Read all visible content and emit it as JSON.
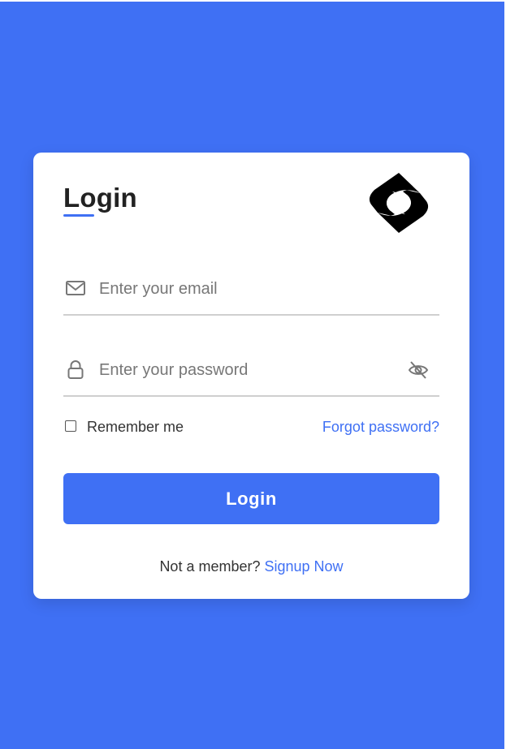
{
  "form": {
    "title": "Login",
    "email_placeholder": "Enter your email",
    "password_placeholder": "Enter your password",
    "remember_label": "Remember me",
    "forgot_label": "Forgot password?",
    "login_button_label": "Login",
    "signup_prompt": "Not a member?",
    "signup_link_label": "Signup Now"
  },
  "icons": {
    "email": "envelope-icon",
    "password": "lock-icon",
    "toggle_password": "eye-slash-icon",
    "logo": "s-logo-icon"
  },
  "colors": {
    "background": "#3f70f4",
    "accent": "#3f70f4",
    "card": "#ffffff",
    "text": "#222222"
  }
}
